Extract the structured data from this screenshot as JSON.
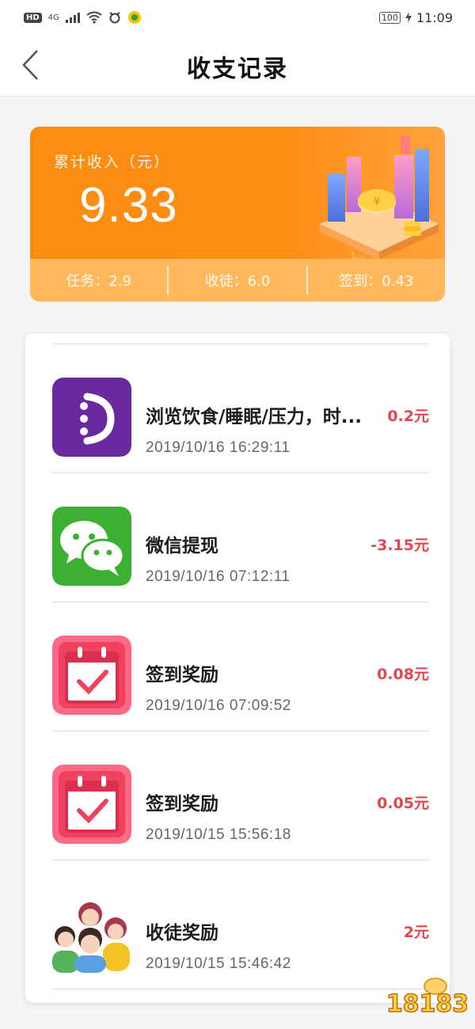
{
  "status_bar": {
    "network_badge": "HD",
    "network_type": "4G",
    "battery": "100",
    "time": "11:09"
  },
  "nav": {
    "back_icon": "chevron-left-icon",
    "title": "收支记录"
  },
  "summary": {
    "label": "累计收入（元）",
    "total": "9.33",
    "stats": [
      {
        "text": "任务：2.9"
      },
      {
        "text": "收徒：6.0"
      },
      {
        "text": "签到：0.43"
      }
    ],
    "colors": {
      "card": "#fd8c12",
      "bottom_bar": "#ffb85c"
    }
  },
  "records": [
    {
      "icon": "health-app-icon",
      "name": "浏览饮食/睡眠/压力，时...",
      "time": "2019/10/16 16:29:11",
      "amount": "0.2元"
    },
    {
      "icon": "wechat-icon",
      "name": "微信提现",
      "time": "2019/10/16 07:12:11",
      "amount": "-3.15元"
    },
    {
      "icon": "calendar-check-icon",
      "name": "签到奖励",
      "time": "2019/10/16 07:09:52",
      "amount": "0.08元"
    },
    {
      "icon": "calendar-check-icon",
      "name": "签到奖励",
      "time": "2019/10/15 15:56:18",
      "amount": "0.05元"
    },
    {
      "icon": "people-group-icon",
      "name": "收徒奖励",
      "time": "2019/10/15 15:46:42",
      "amount": "2元"
    }
  ],
  "colors": {
    "amount": "#e0474f",
    "accent": "#fd8c12"
  },
  "watermark": "18183"
}
